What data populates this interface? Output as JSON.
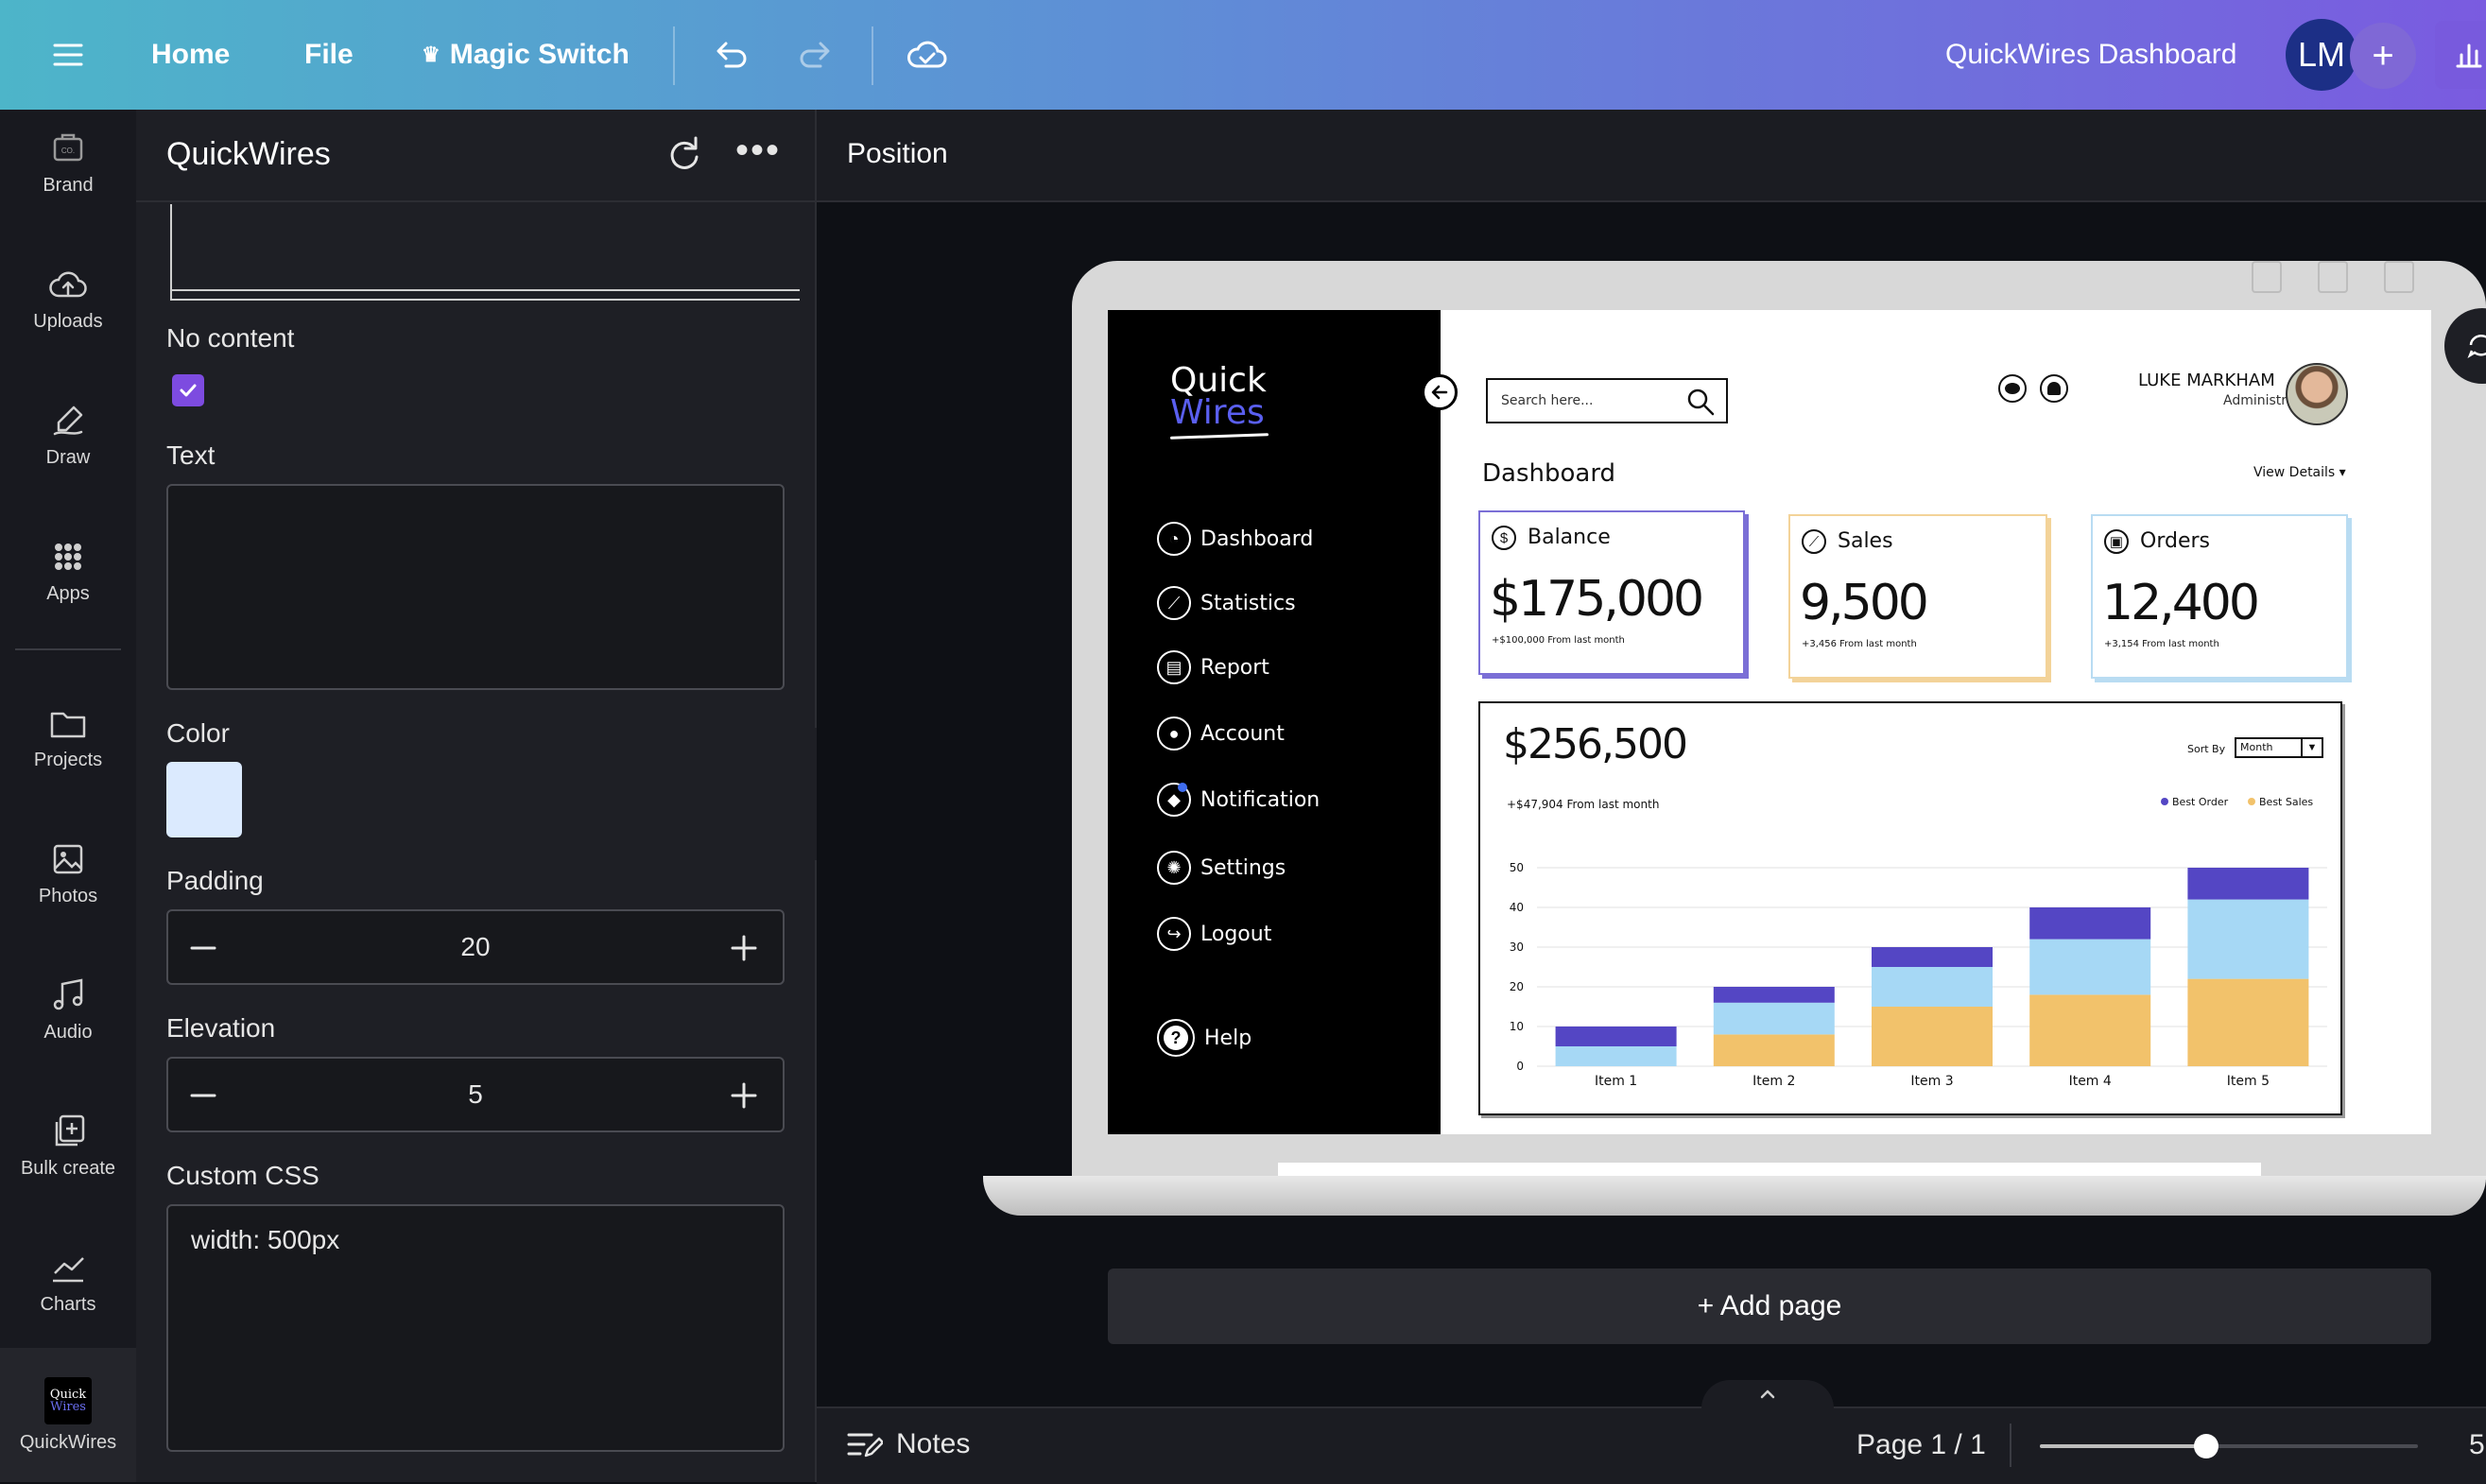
{
  "topbar": {
    "home": "Home",
    "file": "File",
    "magic_switch": "Magic Switch",
    "design_title": "QuickWires Dashboard",
    "avatar_initials": "LM"
  },
  "rail": [
    {
      "label": "Brand",
      "icon": "brand-icon"
    },
    {
      "label": "Uploads",
      "icon": "upload-icon"
    },
    {
      "label": "Draw",
      "icon": "draw-icon"
    },
    {
      "label": "Apps",
      "icon": "apps-icon"
    },
    {
      "label": "Projects",
      "icon": "folder-icon"
    },
    {
      "label": "Photos",
      "icon": "photo-icon"
    },
    {
      "label": "Audio",
      "icon": "audio-icon"
    },
    {
      "label": "Bulk create",
      "icon": "bulk-create-icon"
    },
    {
      "label": "Charts",
      "icon": "chart-icon"
    },
    {
      "label": "QuickWires",
      "icon": "quickwires-logo"
    }
  ],
  "rail_logo_text": {
    "line1": "Quick",
    "line2": "Wires"
  },
  "panel": {
    "title": "QuickWires",
    "no_content_label": "No content",
    "no_content_checked": true,
    "text_label": "Text",
    "text_value": "",
    "color_label": "Color",
    "color_value": "#dbeafe",
    "padding_label": "Padding",
    "padding_value": "20",
    "elevation_label": "Elevation",
    "elevation_value": "5",
    "css_label": "Custom CSS",
    "css_value": "width: 500px"
  },
  "position_title": "Position",
  "add_page": "+ Add page",
  "bottom": {
    "notes": "Notes",
    "page": "Page 1 / 1",
    "zoom_fraction": 0.44,
    "zoom_cut": "5"
  },
  "dashboard": {
    "logo_line1": "Quick",
    "logo_line2": "Wires",
    "nav": [
      "Dashboard",
      "Statistics",
      "Report",
      "Account",
      "Notification",
      "Settings",
      "Logout"
    ],
    "help": "Help",
    "search_placeholder": "Search here...",
    "user_name": "LUKE MARKHAM",
    "user_role": "Administrator",
    "heading": "Dashboard",
    "view_details": "View Details ▾",
    "cards": [
      {
        "title": "Balance",
        "value": "$175,000",
        "sub": "+$100,000 From last month",
        "color": "#7b6fd6"
      },
      {
        "title": "Sales",
        "value": "9,500",
        "sub": "+3,456 From last month",
        "color": "#f3d399"
      },
      {
        "title": "Orders",
        "value": "12,400",
        "sub": "+3,154 From last month",
        "color": "#b9dcf2"
      }
    ],
    "chart_total": "$256,500",
    "chart_sub": "+$47,904 From last month",
    "sort_by": "Sort By",
    "sort_value": "Month"
  },
  "chart_data": {
    "type": "bar",
    "stacked": true,
    "categories": [
      "Item 1",
      "Item 2",
      "Item 3",
      "Item 4",
      "Item 5"
    ],
    "series": [
      {
        "name": "",
        "values": [
          0,
          8,
          15,
          18,
          22
        ],
        "color": "#f2c26b"
      },
      {
        "name": "Best Sales",
        "values": [
          5,
          8,
          10,
          14,
          20
        ],
        "color": "#a6d8f5"
      },
      {
        "name": "Best Order",
        "values": [
          5,
          4,
          5,
          8,
          8
        ],
        "color": "#5446c4"
      }
    ],
    "legend": [
      "Best Order",
      "Best Sales"
    ],
    "legend_position": "top-right",
    "yticks": [
      0,
      10,
      20,
      30,
      40,
      50
    ],
    "ytick_labels": [
      "0",
      "10",
      "20",
      "30",
      "40",
      "50"
    ],
    "ylim": [
      0,
      50
    ],
    "grid": true
  }
}
